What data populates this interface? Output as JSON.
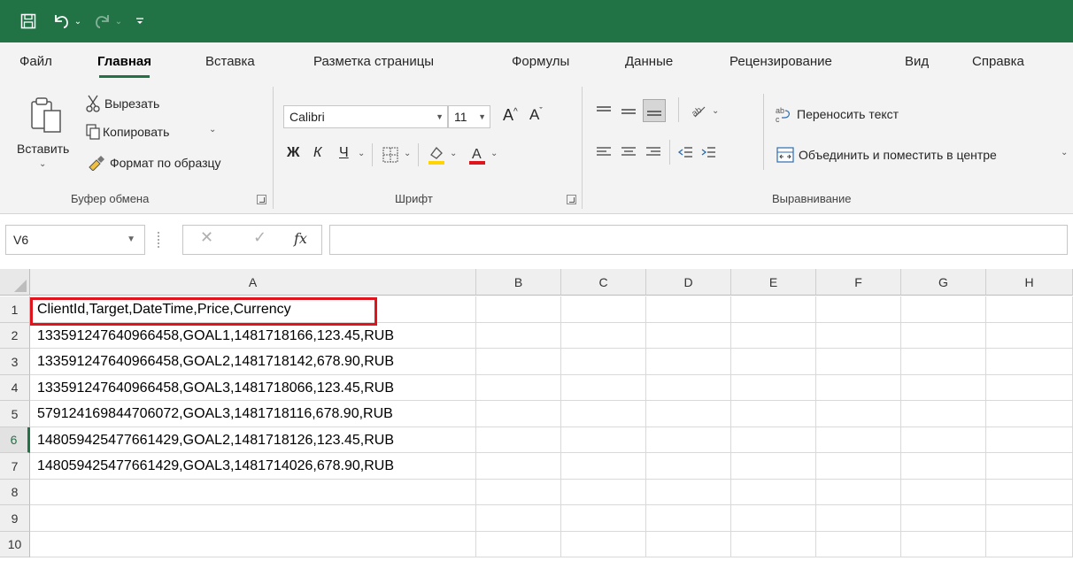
{
  "quick_access": {
    "save_icon": "save-icon",
    "undo_icon": "undo-icon",
    "redo_icon": "redo-icon",
    "customize_icon": "customize-icon"
  },
  "tabs": [
    {
      "label": "Файл"
    },
    {
      "label": "Главная",
      "active": true
    },
    {
      "label": "Вставка"
    },
    {
      "label": "Разметка страницы"
    },
    {
      "label": "Формулы"
    },
    {
      "label": "Данные"
    },
    {
      "label": "Рецензирование"
    },
    {
      "label": "Вид"
    },
    {
      "label": "Справка"
    }
  ],
  "ribbon": {
    "clipboard": {
      "paste": "Вставить",
      "cut": "Вырезать",
      "copy": "Копировать",
      "format_painter": "Формат по образцу",
      "group_label": "Буфер обмена"
    },
    "font": {
      "name": "Calibri",
      "size": "11",
      "bold": "Ж",
      "italic": "К",
      "underline": "Ч",
      "group_label": "Шрифт"
    },
    "alignment": {
      "wrap_text": "Переносить текст",
      "merge_center": "Объединить и поместить в центре",
      "group_label": "Выравнивание"
    }
  },
  "formula_bar": {
    "name_box": "V6",
    "fx_label": "fx",
    "value": ""
  },
  "grid": {
    "columns": [
      "A",
      "B",
      "C",
      "D",
      "E",
      "F",
      "G",
      "H"
    ],
    "row_numbers": [
      "1",
      "2",
      "3",
      "4",
      "5",
      "6",
      "7",
      "8",
      "9",
      "10"
    ],
    "selected_row": "6",
    "cells_a": [
      "ClientId,Target,DateTime,Price,Currency",
      "13359124764096645‍8,GOAL1,1481718166,123.45,RUB",
      "133591247640966458,GOAL2,1481718142,678.90,RUB",
      "133591247640966458,GOAL3,1481718066,123.45,RUB",
      "579124169844706072,GOAL3,1481718116,678.90,RUB",
      "148059425477661429,GOAL2,1481718126,123.45,RUB",
      "148059425477661429,GOAL3,1481714026,678.90,RUB",
      "",
      "",
      ""
    ]
  },
  "colors": {
    "accent": "#217346",
    "highlight_border": "#e0141d"
  }
}
